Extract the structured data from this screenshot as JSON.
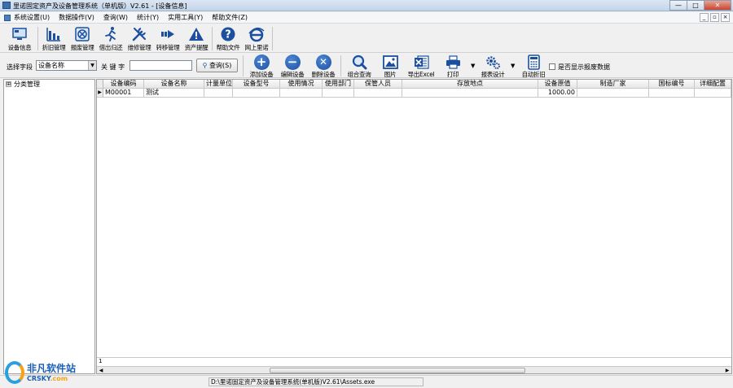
{
  "window": {
    "title": "里诺固定资产及设备管理系统（单机版）V2.61 - [设备信息]",
    "buttons": {
      "minimize": "—",
      "maximize": "□",
      "close": "✕"
    }
  },
  "menubar": {
    "items": [
      "系统设置(U)",
      "数据操作(V)",
      "查询(W)",
      "统计(Y)",
      "实用工具(Y)",
      "帮助文件(Z)"
    ],
    "mdi_buttons": [
      "_",
      "▫",
      "×"
    ]
  },
  "toolbar": {
    "items": [
      {
        "label": "设备信息",
        "icon": "monitor-icon"
      },
      {
        "label": "折旧管理",
        "icon": "bar-chart-icon"
      },
      {
        "label": "报废管理",
        "icon": "scrap-icon"
      },
      {
        "label": "借出归还",
        "icon": "runner-icon"
      },
      {
        "label": "维修管理",
        "icon": "tools-icon"
      },
      {
        "label": "转移管理",
        "icon": "arrow-right-icon"
      },
      {
        "label": "资产提醒",
        "icon": "warning-icon"
      },
      {
        "label": "帮助文件",
        "icon": "help-icon"
      },
      {
        "label": "网上里诺",
        "icon": "internet-icon"
      }
    ]
  },
  "search": {
    "field_label": "选择字段",
    "field_value": "设备名称",
    "keyword_label": "关 键 字",
    "keyword_value": "",
    "query_button": "查询(S)"
  },
  "actions": {
    "items": [
      {
        "label": "添加设备",
        "icon": "add-icon"
      },
      {
        "label": "编辑设备",
        "icon": "minus-icon"
      },
      {
        "label": "删除设备",
        "icon": "delete-icon"
      },
      {
        "label": "组合查询",
        "icon": "magnifier-icon"
      },
      {
        "label": "图片",
        "icon": "picture-icon"
      },
      {
        "label": "导出Excel",
        "icon": "excel-icon"
      },
      {
        "label": "打印",
        "icon": "printer-icon"
      },
      {
        "label": "报表设计",
        "icon": "gears-icon"
      },
      {
        "label": "自动折旧",
        "icon": "calculator-icon"
      }
    ],
    "show_scrapped_label": "是否显示报废数据",
    "show_scrapped_checked": false
  },
  "tree": {
    "root": {
      "expander": "⊞",
      "label": "分类管理"
    }
  },
  "grid": {
    "columns": [
      "设备编码",
      "设备名称",
      "计量单位",
      "设备型号",
      "使用情况",
      "使用部门",
      "保管人员",
      "存放地点",
      "设备原值",
      "制造厂家",
      "国标编号",
      "详细配置"
    ],
    "rows": [
      {
        "marker": "▶",
        "cells": [
          "M00001",
          "测试",
          "",
          "",
          "",
          "",
          "",
          "",
          "1000.00",
          "",
          "",
          ""
        ]
      }
    ],
    "footer_count": "1"
  },
  "statusbar": {
    "path": "D:\\里诺固定资产及设备管理系统(单机版)V2.61\\Assets.exe"
  },
  "watermark": {
    "text": "非凡软件站",
    "sub_part1": "CRSKY",
    "sub_part2": ".com"
  },
  "colors": {
    "icon_blue": "#1c4f9f",
    "excel_green": "#1d7a3a",
    "warning_red": "#c0392b"
  }
}
